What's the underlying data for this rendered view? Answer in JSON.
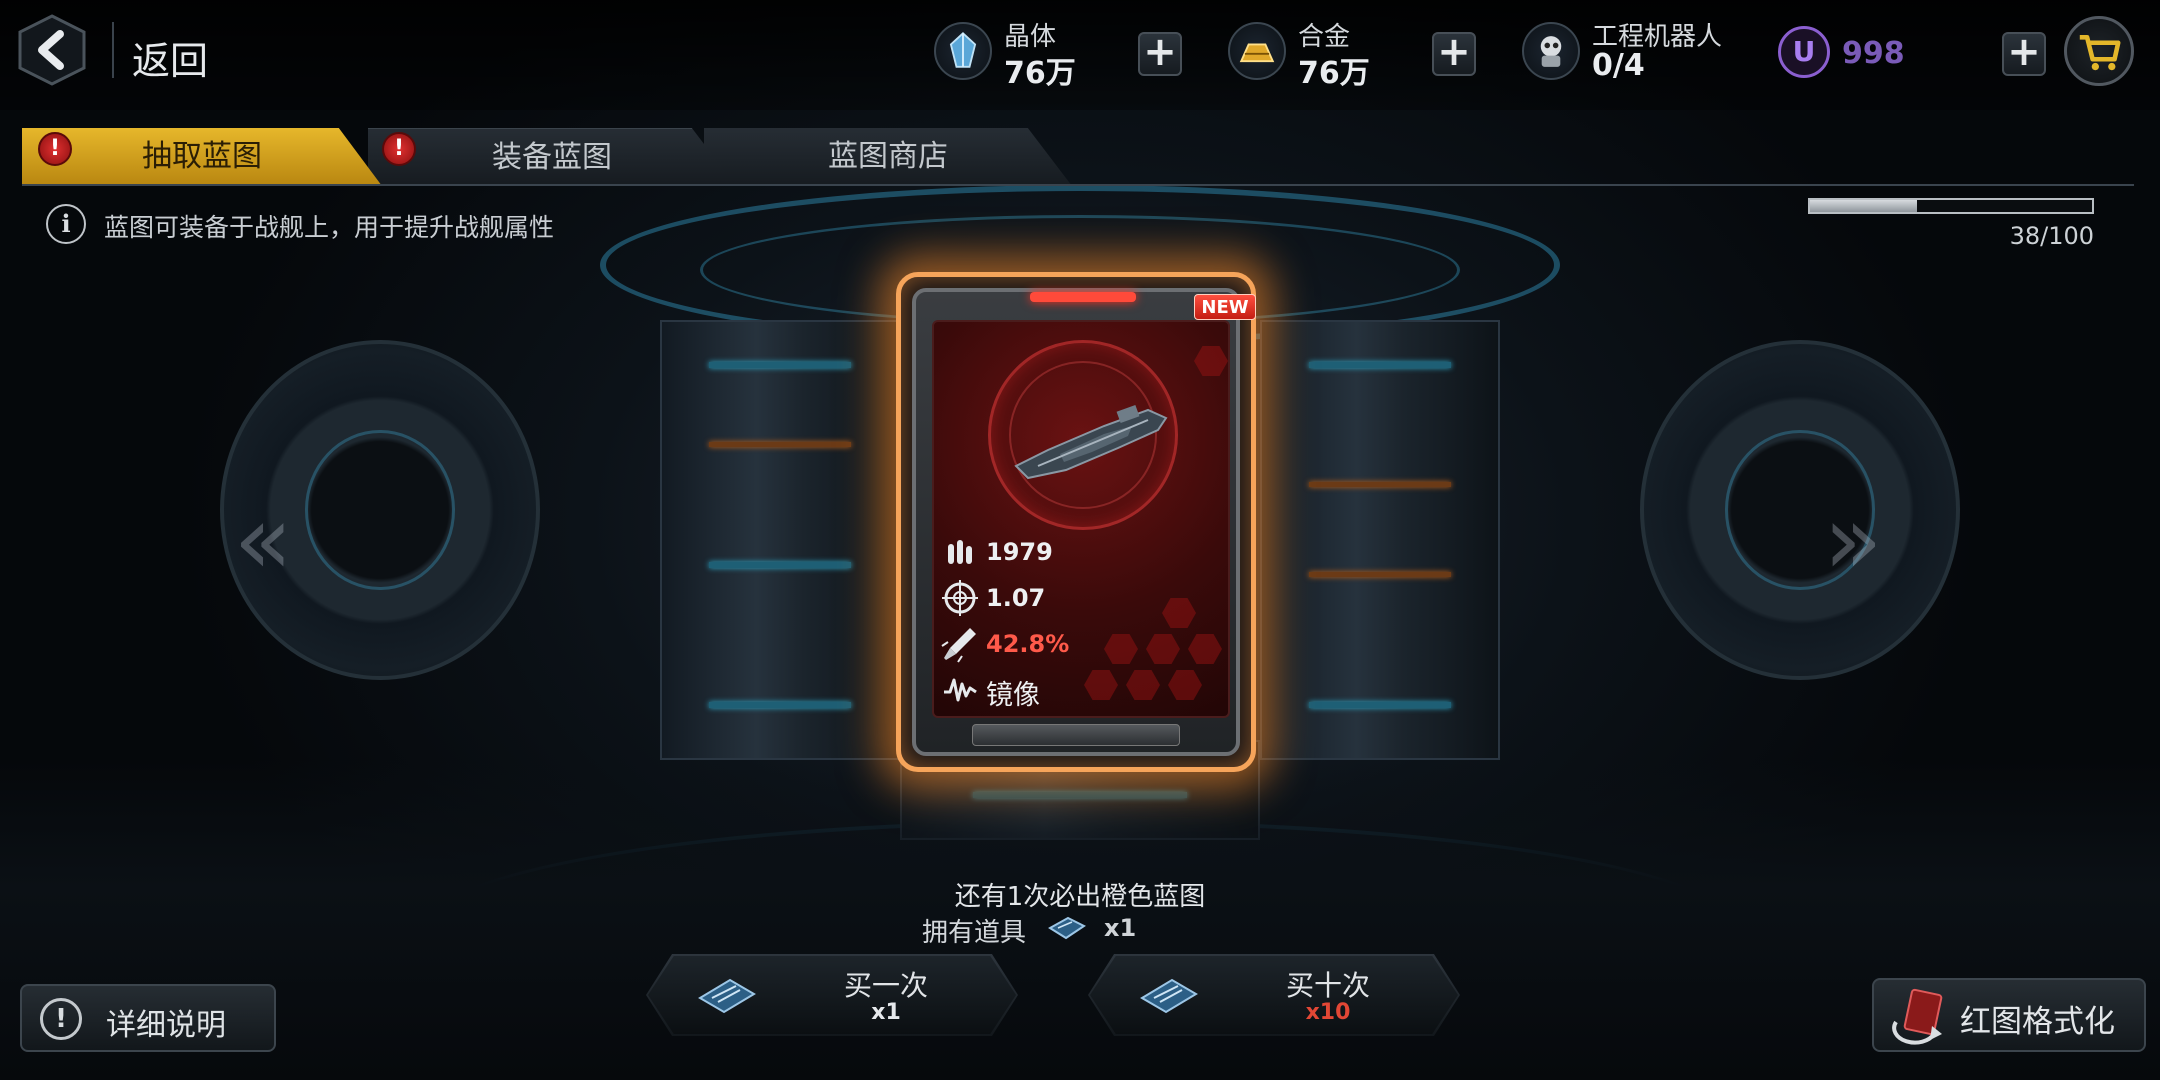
{
  "header": {
    "back_label": "返回",
    "resources": [
      {
        "name": "晶体",
        "value": "76万",
        "icon": "crystal-icon"
      },
      {
        "name": "合金",
        "value": "76万",
        "icon": "alloy-icon"
      },
      {
        "name": "工程机器人",
        "value": "0/4",
        "icon": "robot-icon"
      }
    ],
    "premium": {
      "icon_letter": "U",
      "value": "998"
    },
    "plus_label": "+"
  },
  "tabs": [
    {
      "label": "抽取蓝图",
      "active": true,
      "alert": true
    },
    {
      "label": "装备蓝图",
      "active": false,
      "alert": true
    },
    {
      "label": "蓝图商店",
      "active": false,
      "alert": false
    }
  ],
  "alert_mark": "!",
  "info": {
    "icon_letter": "i",
    "text": "蓝图可装备于战舰上，用于提升战舰属性"
  },
  "progress": {
    "current": 38,
    "max": 100,
    "text": "38/100"
  },
  "navigation": {
    "prev": "«",
    "next": "»"
  },
  "card": {
    "badge": "NEW",
    "stats": [
      {
        "icon": "ammo-icon",
        "value": "1979"
      },
      {
        "icon": "crosshair-icon",
        "value": "1.07"
      },
      {
        "icon": "missile-icon",
        "value": "42.8%"
      },
      {
        "icon": "skill-icon",
        "value": "镜像"
      }
    ]
  },
  "footer": {
    "guarantee_text": "还有1次必出橙色蓝图",
    "owned_label": "拥有道具",
    "owned_count": "x1",
    "buy_once": {
      "label": "买一次",
      "count": "x1"
    },
    "buy_ten": {
      "label": "买十次",
      "count": "x10"
    },
    "detail_label": "详细说明",
    "detail_icon_letter": "!",
    "format_label": "红图格式化"
  },
  "colors": {
    "accent": "#e6b72b",
    "card_glow": "#ff8c28",
    "alert": "#e03030",
    "premium": "#8b5fd0"
  }
}
